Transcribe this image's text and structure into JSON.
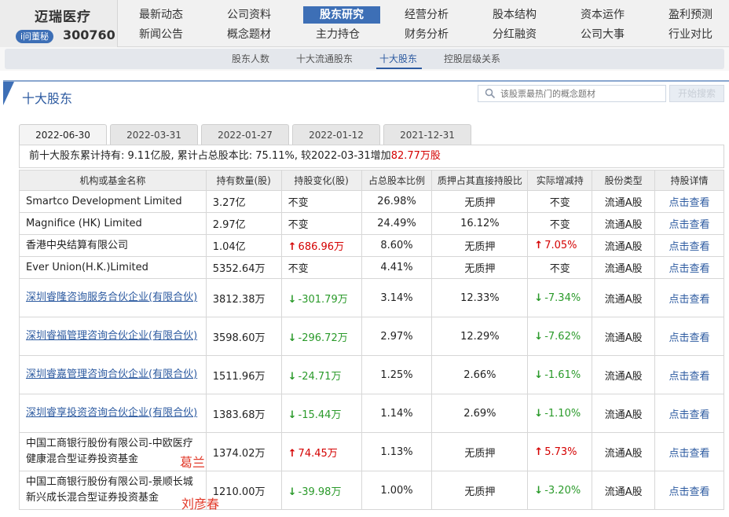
{
  "brand": {
    "name": "迈瑞医疗",
    "badge": "i问董秘",
    "code": "300760"
  },
  "nav": {
    "row1": [
      "最新动态",
      "公司资料",
      "股东研究",
      "经营分析",
      "股本结构",
      "资本运作",
      "盈利预测"
    ],
    "row2": [
      "新闻公告",
      "概念题材",
      "主力持仓",
      "财务分析",
      "分红融资",
      "公司大事",
      "行业对比"
    ],
    "active": "股东研究"
  },
  "subnav": {
    "items": [
      "股东人数",
      "十大流通股东",
      "十大股东",
      "控股层级关系"
    ],
    "active": "十大股东"
  },
  "panel": {
    "title": "十大股东"
  },
  "search": {
    "placeholder": "该股票最热门的概念题材",
    "button": "开始搜索"
  },
  "tabs": [
    "2022-06-30",
    "2022-03-31",
    "2022-01-27",
    "2022-01-12",
    "2021-12-31"
  ],
  "active_tab": "2022-06-30",
  "summary": {
    "prefix": "前十大股东累计持有:",
    "shares": "9.11亿股,",
    "ratio_label": "累计占总股本比:",
    "ratio": "75.11%,",
    "compare": "较2022-03-31增加",
    "increase": "82.77万股"
  },
  "columns": [
    "机构或基金名称",
    "持有数量(股)",
    "持股变化(股)",
    "占总股本比例",
    "质押占其直接持股比",
    "实际增减持",
    "股份类型",
    "持股详情"
  ],
  "rows": [
    {
      "name": "Smartco Development Limited",
      "link": false,
      "qty": "3.27亿",
      "change": "不变",
      "change_dir": "none",
      "pct": "26.98%",
      "pledge": "无质押",
      "actual": "不变",
      "actual_dir": "none",
      "type": "流通A股",
      "detail": "点击查看"
    },
    {
      "name": "Magnifice (HK) Limited",
      "link": false,
      "qty": "2.97亿",
      "change": "不变",
      "change_dir": "none",
      "pct": "24.49%",
      "pledge": "16.12%",
      "actual": "不变",
      "actual_dir": "none",
      "type": "流通A股",
      "detail": "点击查看"
    },
    {
      "name": "香港中央结算有限公司",
      "link": false,
      "qty": "1.04亿",
      "change": "686.96万",
      "change_dir": "up",
      "pct": "8.60%",
      "pledge": "无质押",
      "actual": "7.05%",
      "actual_dir": "up",
      "type": "流通A股",
      "detail": "点击查看"
    },
    {
      "name": "Ever Union(H.K.)Limited",
      "link": false,
      "qty": "5352.64万",
      "change": "不变",
      "change_dir": "none",
      "pct": "4.41%",
      "pledge": "无质押",
      "actual": "不变",
      "actual_dir": "none",
      "type": "流通A股",
      "detail": "点击查看"
    },
    {
      "name": "深圳睿隆咨询服务合伙企业(有限合伙)",
      "link": true,
      "qty": "3812.38万",
      "change": "-301.79万",
      "change_dir": "down",
      "pct": "3.14%",
      "pledge": "12.33%",
      "actual": "-7.34%",
      "actual_dir": "down",
      "type": "流通A股",
      "detail": "点击查看"
    },
    {
      "name": "深圳睿福管理咨询合伙企业(有限合伙)",
      "link": true,
      "qty": "3598.60万",
      "change": "-296.72万",
      "change_dir": "down",
      "pct": "2.97%",
      "pledge": "12.29%",
      "actual": "-7.62%",
      "actual_dir": "down",
      "type": "流通A股",
      "detail": "点击查看"
    },
    {
      "name": "深圳睿嘉管理咨询合伙企业(有限合伙)",
      "link": true,
      "qty": "1511.96万",
      "change": "-24.71万",
      "change_dir": "down",
      "pct": "1.25%",
      "pledge": "2.66%",
      "actual": "-1.61%",
      "actual_dir": "down",
      "type": "流通A股",
      "detail": "点击查看"
    },
    {
      "name": "深圳睿享投资咨询合伙企业(有限合伙)",
      "link": true,
      "qty": "1383.68万",
      "change": "-15.44万",
      "change_dir": "down",
      "pct": "1.14%",
      "pledge": "2.69%",
      "actual": "-1.10%",
      "actual_dir": "down",
      "type": "流通A股",
      "detail": "点击查看"
    },
    {
      "name": "中国工商银行股份有限公司-中欧医疗健康混合型证券投资基金",
      "link": false,
      "qty": "1374.02万",
      "change": "74.45万",
      "change_dir": "up",
      "pct": "1.13%",
      "pledge": "无质押",
      "actual": "5.73%",
      "actual_dir": "up",
      "type": "流通A股",
      "detail": "点击查看"
    },
    {
      "name": "中国工商银行股份有限公司-景顺长城新兴成长混合型证券投资基金",
      "link": false,
      "qty": "1210.00万",
      "change": "-39.98万",
      "change_dir": "down",
      "pct": "1.00%",
      "pledge": "无质押",
      "actual": "-3.20%",
      "actual_dir": "down",
      "type": "流通A股",
      "detail": "点击查看"
    }
  ],
  "annotations": [
    "葛兰",
    "刘彦春"
  ],
  "colors": {
    "accent": "#3d6fb6",
    "link": "#2c5aa0",
    "up": "#d40000",
    "down": "#2a9a2a",
    "annotation": "#e23a2a"
  }
}
